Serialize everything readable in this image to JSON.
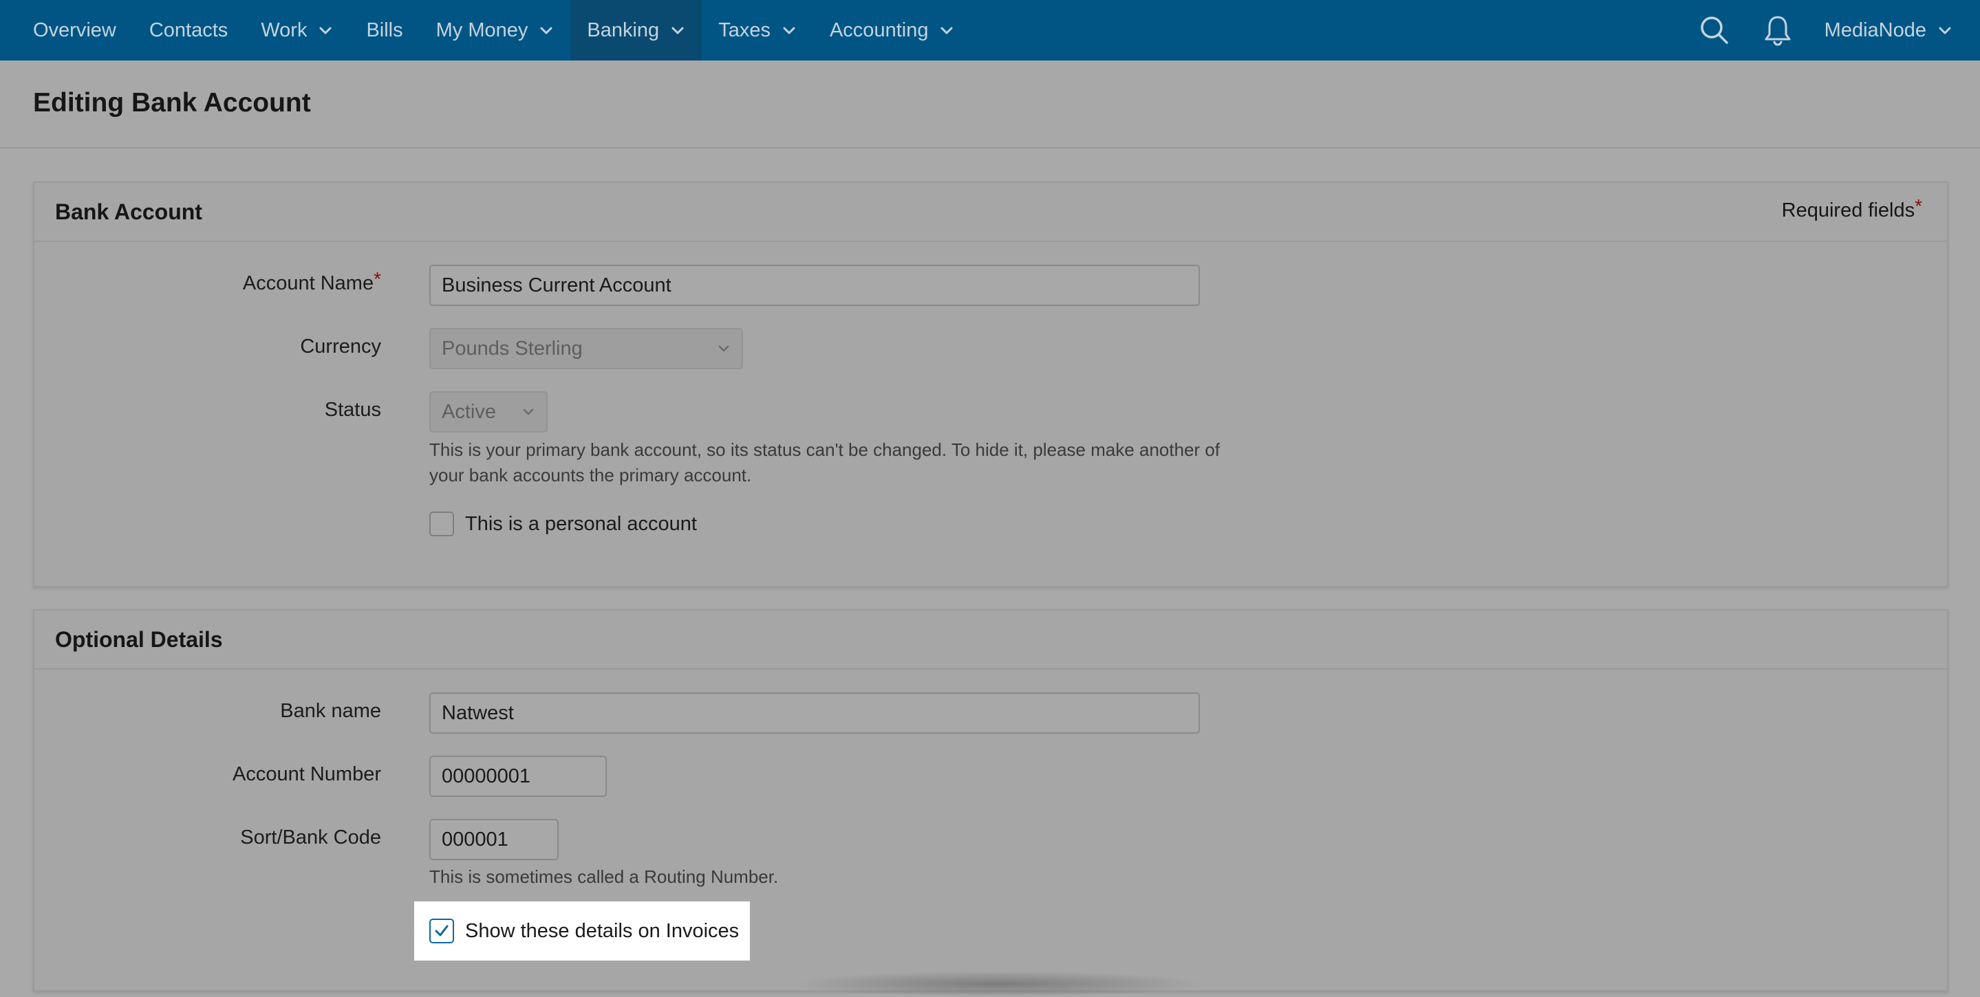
{
  "nav": {
    "items": [
      {
        "label": "Overview",
        "dropdown": false,
        "active": false
      },
      {
        "label": "Contacts",
        "dropdown": false,
        "active": false
      },
      {
        "label": "Work",
        "dropdown": true,
        "active": false
      },
      {
        "label": "Bills",
        "dropdown": false,
        "active": false
      },
      {
        "label": "My Money",
        "dropdown": true,
        "active": false
      },
      {
        "label": "Banking",
        "dropdown": true,
        "active": true
      },
      {
        "label": "Taxes",
        "dropdown": true,
        "active": false
      },
      {
        "label": "Accounting",
        "dropdown": true,
        "active": false
      }
    ],
    "search_icon": "search-icon",
    "notifications_icon": "bell-icon",
    "account_name": "MediaNode"
  },
  "page": {
    "title": "Editing Bank Account"
  },
  "bank_account": {
    "title": "Bank Account",
    "required_note": "Required fields",
    "required_star": "*",
    "account_name_label": "Account Name",
    "account_name_value": "Business Current Account",
    "currency_label": "Currency",
    "currency_value": "Pounds Sterling",
    "status_label": "Status",
    "status_value": "Active",
    "status_help": "This is your primary bank account, so its status can't be changed. To hide it, please make another of your bank accounts the primary account.",
    "personal_label": "This is a personal account",
    "personal_checked": false
  },
  "optional_details": {
    "title": "Optional Details",
    "bank_name_label": "Bank name",
    "bank_name_value": "Natwest",
    "account_number_label": "Account Number",
    "account_number_value": "00000001",
    "sort_code_label": "Sort/Bank Code",
    "sort_code_value": "000001",
    "sort_code_help": "This is sometimes called a Routing Number.",
    "show_on_invoices_label": "Show these details on Invoices",
    "show_on_invoices_checked": true
  },
  "colors": {
    "nav_bg": "#005585",
    "nav_active_bg": "#0b4a70",
    "nav_text": "#c4d4df",
    "required_star": "#8b0a0a",
    "checkbox_accent": "#0a6aa0"
  }
}
